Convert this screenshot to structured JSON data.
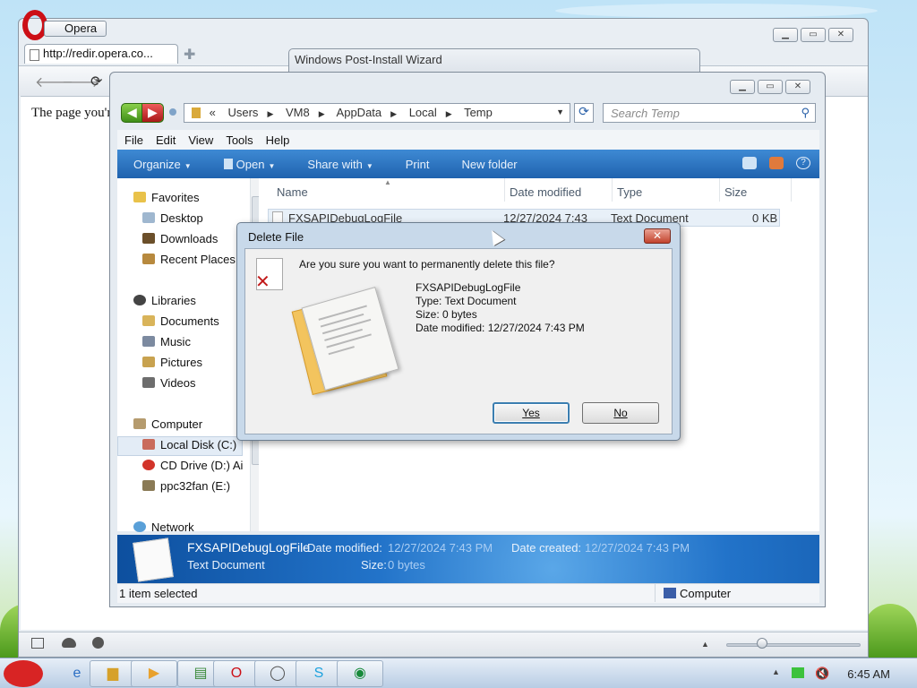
{
  "browser": {
    "menu_label": "Opera",
    "tab_title": "http://redir.opera.co...",
    "page_text": "The page you'r"
  },
  "background_window": {
    "title": "Windows Post-Install Wizard"
  },
  "explorer": {
    "breadcrumb": [
      "«",
      "Users",
      "VM8",
      "AppData",
      "Local",
      "Temp"
    ],
    "search_placeholder": "Search Temp",
    "menus": [
      "File",
      "Edit",
      "View",
      "Tools",
      "Help"
    ],
    "commands": [
      "Organize",
      "Open",
      "Share with",
      "Print",
      "New folder"
    ],
    "nav": {
      "favorites_label": "Favorites",
      "favorites": [
        "Desktop",
        "Downloads",
        "Recent Places"
      ],
      "libraries_label": "Libraries",
      "libraries": [
        "Documents",
        "Music",
        "Pictures",
        "Videos"
      ],
      "computer_label": "Computer",
      "drives": [
        "Local Disk (C:)",
        "CD Drive (D:) Ai",
        "ppc32fan (E:)"
      ],
      "network_label": "Network"
    },
    "columns": [
      "Name",
      "Date modified",
      "Type",
      "Size"
    ],
    "files": [
      {
        "name": "FXSAPIDebugLogFile",
        "date": "12/27/2024 7:43",
        "type": "Text Document",
        "size": "0 KB"
      }
    ],
    "details": {
      "name": "FXSAPIDebugLogFile",
      "type": "Text Document",
      "modified_label": "Date modified:",
      "modified": "12/27/2024 7:43 PM",
      "created_label": "Date created:",
      "created": "12/27/2024 7:43 PM",
      "size_label": "Size:",
      "size": "0 bytes"
    },
    "status_left": "1 item selected",
    "status_right": "Computer"
  },
  "dialog": {
    "title": "Delete File",
    "message": "Are you sure you want to permanently delete this file?",
    "file_name": "FXSAPIDebugLogFile",
    "file_type": "Type: Text Document",
    "file_size": "Size: 0 bytes",
    "file_modified": "Date modified: 12/27/2024 7:43 PM",
    "yes_label": "Yes",
    "no_label": "No",
    "close_glyph": "✕"
  },
  "taskbar": {
    "clock": "6:45 AM"
  }
}
